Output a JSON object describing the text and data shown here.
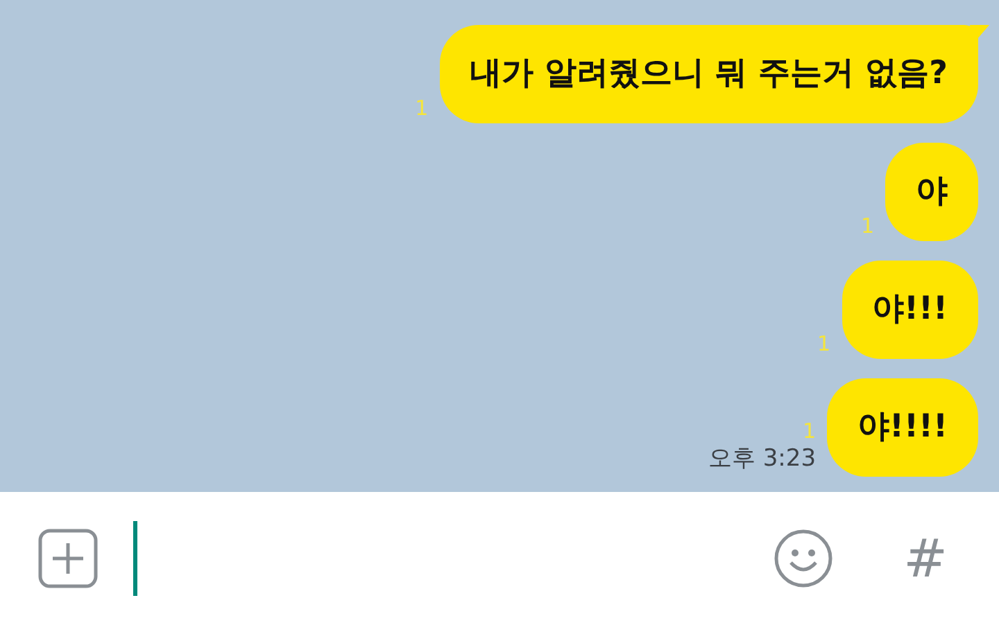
{
  "messages": [
    {
      "text": "내가 알려줬으니 뭐 주는거 없음?",
      "unread": "1",
      "tail": true
    },
    {
      "text": "야",
      "unread": "1",
      "tail": false
    },
    {
      "text": "야!!!",
      "unread": "1",
      "tail": false
    },
    {
      "text": "야!!!!",
      "unread": "1",
      "time": "오후 3:23",
      "tail": false
    }
  ],
  "composer": {
    "hash_button": "#"
  }
}
